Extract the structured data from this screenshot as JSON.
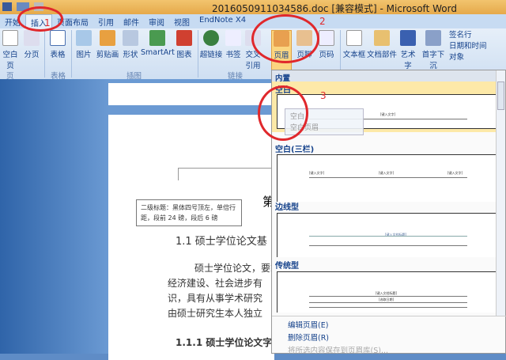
{
  "window": {
    "title": "201605091103458б.doc [兼容模式] - Microsoft Word"
  },
  "tabs": [
    "开始",
    "插入",
    "页面布局",
    "引用",
    "邮件",
    "审阅",
    "视图",
    "EndNote X4"
  ],
  "ribbon": {
    "buttons": [
      "空白页",
      "分页",
      "表格",
      "图片",
      "剪贴画",
      "形状",
      "SmartArt",
      "图表",
      "超链接",
      "书签",
      "交叉引用",
      "页眉",
      "页脚",
      "页码",
      "文本框",
      "文档部件",
      "艺术字",
      "首字下沉"
    ],
    "small": [
      "签名行",
      "日期和时间",
      "对象"
    ],
    "groups": [
      "页",
      "表格",
      "插图",
      "链接"
    ]
  },
  "document": {
    "note": "二级标题：黑体四号顶左，单倍行距，段前 24 磅，段后 6 磅",
    "heading_partial": "第",
    "h2": "1.1  硕士学位论文基",
    "para": [
      "硕士学位论文，要求",
      "经济建设、社会进步有",
      "识，具有从事学术研究",
      "由硕士研究生本人独立"
    ],
    "h3": "1.1.1  硕士学位论文字"
  },
  "panel": {
    "header": "内置",
    "sections": [
      "空白",
      "空白(三栏)",
      "边线型",
      "传统型"
    ],
    "tooltip": {
      "title": "空白",
      "desc": "空白页眉"
    },
    "placeholders": {
      "text": "[键入文字]",
      "title": "[键入文档标题]",
      "date": "[选取日期]"
    },
    "menu": [
      "编辑页眉(E)",
      "删除页眉(R)",
      "将所选内容保存到页眉库(S)..."
    ]
  },
  "annotations": [
    "1",
    "2",
    "3"
  ]
}
